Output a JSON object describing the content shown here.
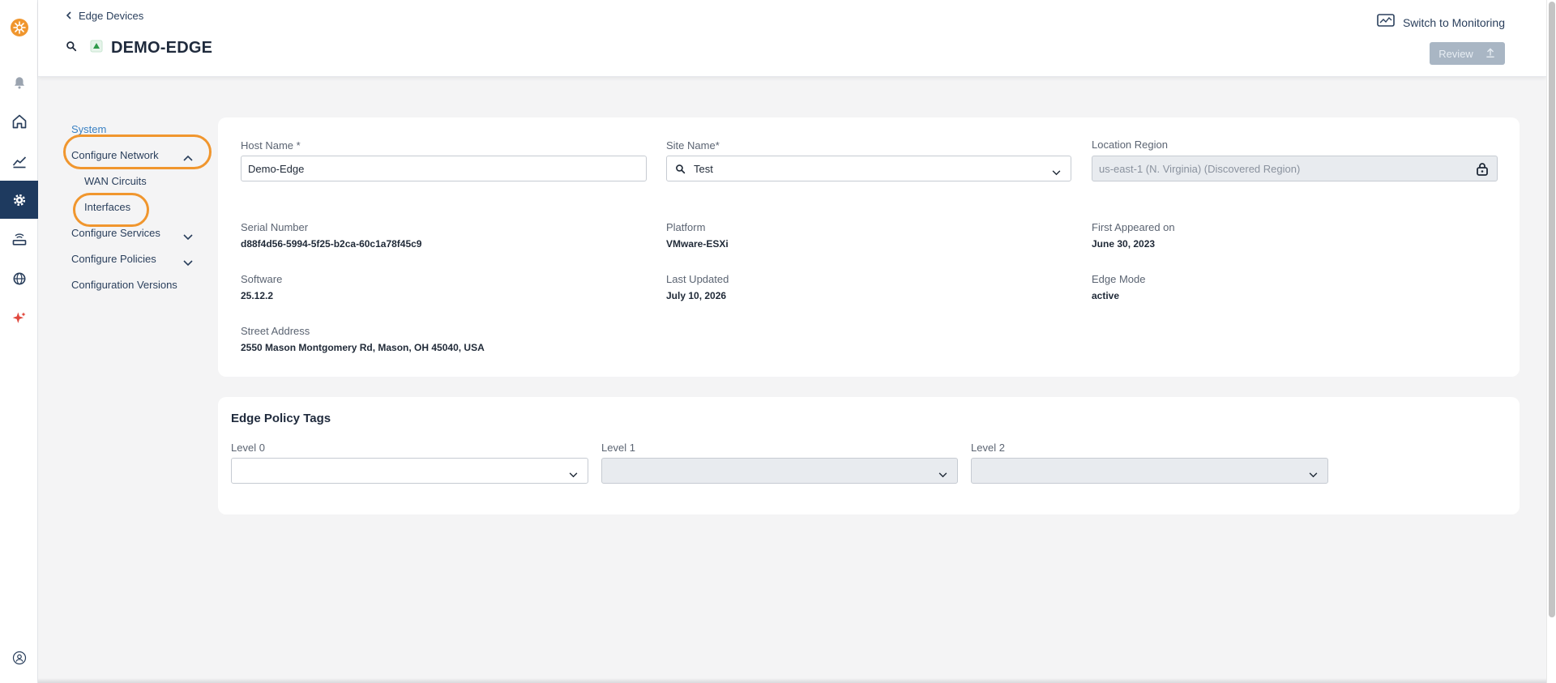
{
  "colors": {
    "brand": "#f0962e",
    "rail_active": "#1e3a5f",
    "link": "#3b82c4",
    "highlight": "#f0962e"
  },
  "rail": {
    "items": [
      {
        "icon": "logo-icon"
      },
      {
        "icon": "bell-icon"
      },
      {
        "icon": "home-icon"
      },
      {
        "icon": "chart-icon"
      },
      {
        "icon": "gear-icon",
        "active": true
      },
      {
        "icon": "router-icon"
      },
      {
        "icon": "globe-icon"
      },
      {
        "icon": "sparkle-icon"
      },
      {
        "icon": "user-icon"
      }
    ]
  },
  "header": {
    "back_label": "Edge Devices",
    "title": "DEMO-EDGE",
    "switch_label": "Switch to Monitoring",
    "review_label": "Review"
  },
  "nav": {
    "system": "System",
    "configure_network": "Configure Network",
    "wan_circuits": "WAN Circuits",
    "interfaces": "Interfaces",
    "configure_services": "Configure Services",
    "configure_policies": "Configure Policies",
    "configuration_versions": "Configuration Versions"
  },
  "device": {
    "host_name_label": "Host Name *",
    "host_name_value": "Demo-Edge",
    "site_name_label": "Site Name*",
    "site_name_value": "Test",
    "location_region_label": "Location Region",
    "location_region_placeholder": "us-east-1 (N. Virginia) (Discovered Region)",
    "serial_label": "Serial Number",
    "serial_value": "d88f4d56-5994-5f25-b2ca-60c1a78f45c9",
    "platform_label": "Platform",
    "platform_value": "VMware-ESXi",
    "first_appeared_label": "First Appeared on",
    "first_appeared_value": "June 30, 2023",
    "software_label": "Software",
    "software_value": "25.12.2",
    "last_updated_label": "Last Updated",
    "last_updated_value": "July 10, 2026",
    "edge_mode_label": "Edge Mode",
    "edge_mode_value": "active",
    "street_label": "Street Address",
    "street_value": "2550 Mason Montgomery Rd, Mason, OH 45040, USA"
  },
  "policy_tags": {
    "title": "Edge Policy Tags",
    "level0_label": "Level 0",
    "level1_label": "Level 1",
    "level2_label": "Level 2"
  }
}
